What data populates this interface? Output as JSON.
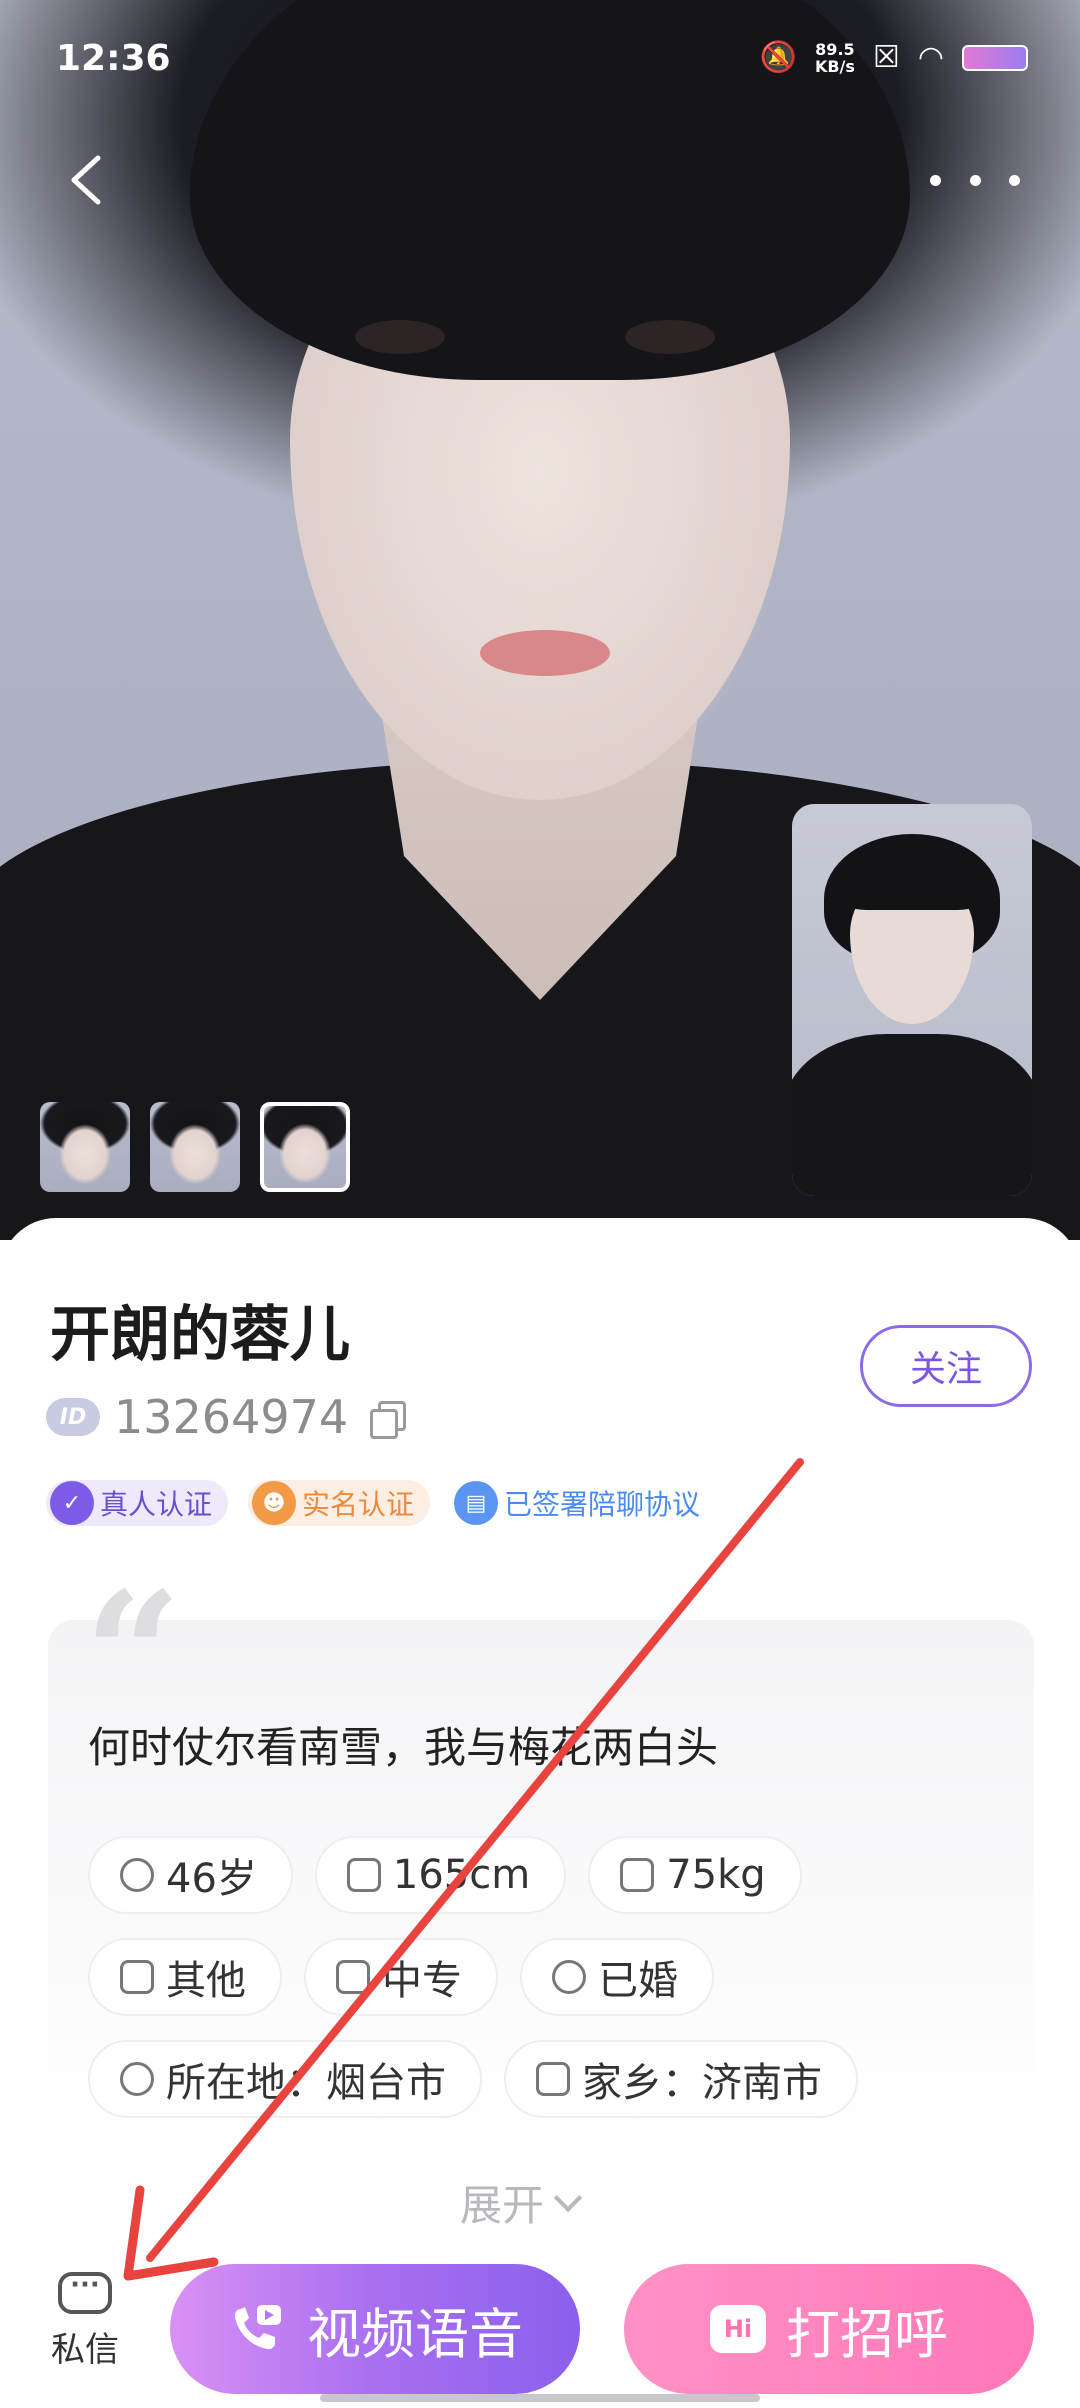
{
  "status_bar": {
    "time": "12:36",
    "net_speed": "89.5",
    "net_unit": "KB/s"
  },
  "profile": {
    "name": "开朗的蓉儿",
    "id_badge": "ID",
    "id_number": "13264974",
    "follow_label": "关注",
    "badges": [
      {
        "label": "真人认证",
        "icon": "verified-icon"
      },
      {
        "label": "实名认证",
        "icon": "id-card-icon"
      },
      {
        "label": "已签署陪聊协议",
        "icon": "document-icon"
      }
    ],
    "quote": "何时仗尔看南雪，我与梅花两白头",
    "attributes": {
      "age": "46岁",
      "height": "165cm",
      "weight": "75kg",
      "occupation": "其他",
      "education": "中专",
      "marital": "已婚",
      "location": "所在地：烟台市",
      "hometown": "家乡：济南市"
    },
    "expand_label": "展开"
  },
  "bottom_bar": {
    "dm_label": "私信",
    "video_label": "视频语音",
    "greet_label": "打招呼",
    "greet_icon_text": "Hi"
  },
  "colors": {
    "accent_purple": "#7b57e0",
    "accent_pink": "#ff78b8",
    "annotation_red": "#e8433f"
  }
}
